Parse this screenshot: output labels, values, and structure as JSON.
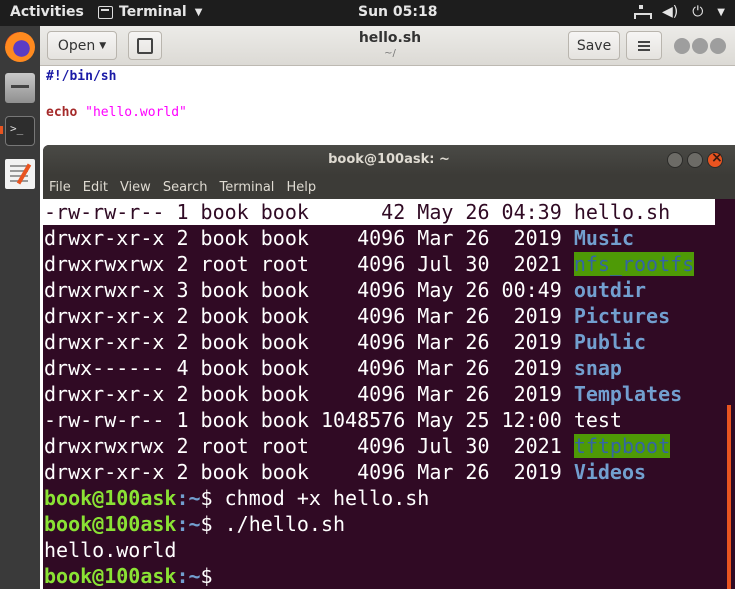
{
  "topbar": {
    "activities": "Activities",
    "app_name": "Terminal",
    "clock": "Sun 05:18",
    "icons": [
      "network-icon",
      "volume-icon",
      "power-icon",
      "chevron-down-icon"
    ]
  },
  "dock": {
    "items": [
      "firefox-icon",
      "files-icon",
      "terminal-icon",
      "text-editor-icon"
    ]
  },
  "gedit": {
    "open_label": "Open",
    "save_label": "Save",
    "title": "hello.sh",
    "subtitle": "~/",
    "lines": {
      "shebang": "#!/bin/sh",
      "echo_kw": "echo",
      "echo_str": "\"hello.world\""
    }
  },
  "terminal": {
    "title": "book@100ask: ~",
    "menu": [
      "File",
      "Edit",
      "View",
      "Search",
      "Terminal",
      "Help"
    ],
    "listing": [
      {
        "meta": "-rw-rw-r-- 1 book book      42 May 26 04:39 ",
        "name": "hello.sh",
        "style": "hl"
      },
      {
        "meta": "drwxr-xr-x 2 book book    4096 Mar 26  2019 ",
        "name": "Music",
        "style": "dir"
      },
      {
        "meta": "drwxrwxrwx 2 root root    4096 Jul 30  2021 ",
        "name": "nfs_rootfs",
        "style": "ow"
      },
      {
        "meta": "drwxrwxr-x 3 book book    4096 May 26 00:49 ",
        "name": "outdir",
        "style": "dir"
      },
      {
        "meta": "drwxr-xr-x 2 book book    4096 Mar 26  2019 ",
        "name": "Pictures",
        "style": "dir"
      },
      {
        "meta": "drwxr-xr-x 2 book book    4096 Mar 26  2019 ",
        "name": "Public",
        "style": "dir"
      },
      {
        "meta": "drwx------ 4 book book    4096 Mar 26  2019 ",
        "name": "snap",
        "style": "dir"
      },
      {
        "meta": "drwxr-xr-x 2 book book    4096 Mar 26  2019 ",
        "name": "Templates",
        "style": "dir"
      },
      {
        "meta": "-rw-rw-r-- 1 book book 1048576 May 25 12:00 ",
        "name": "test",
        "style": "plain"
      },
      {
        "meta": "drwxrwxrwx 2 root root    4096 Jul 30  2021 ",
        "name": "tftpboot",
        "style": "ow"
      },
      {
        "meta": "drwxr-xr-x 2 book book    4096 Mar 26  2019 ",
        "name": "Videos",
        "style": "dir"
      }
    ],
    "prompt_user": "book@100ask",
    "prompt_path": ":~",
    "prompt_sign": "$ ",
    "cmd1": "chmod +x hello.sh",
    "cmd2": "./hello.sh",
    "output": "hello.world",
    "cmd3": ""
  }
}
